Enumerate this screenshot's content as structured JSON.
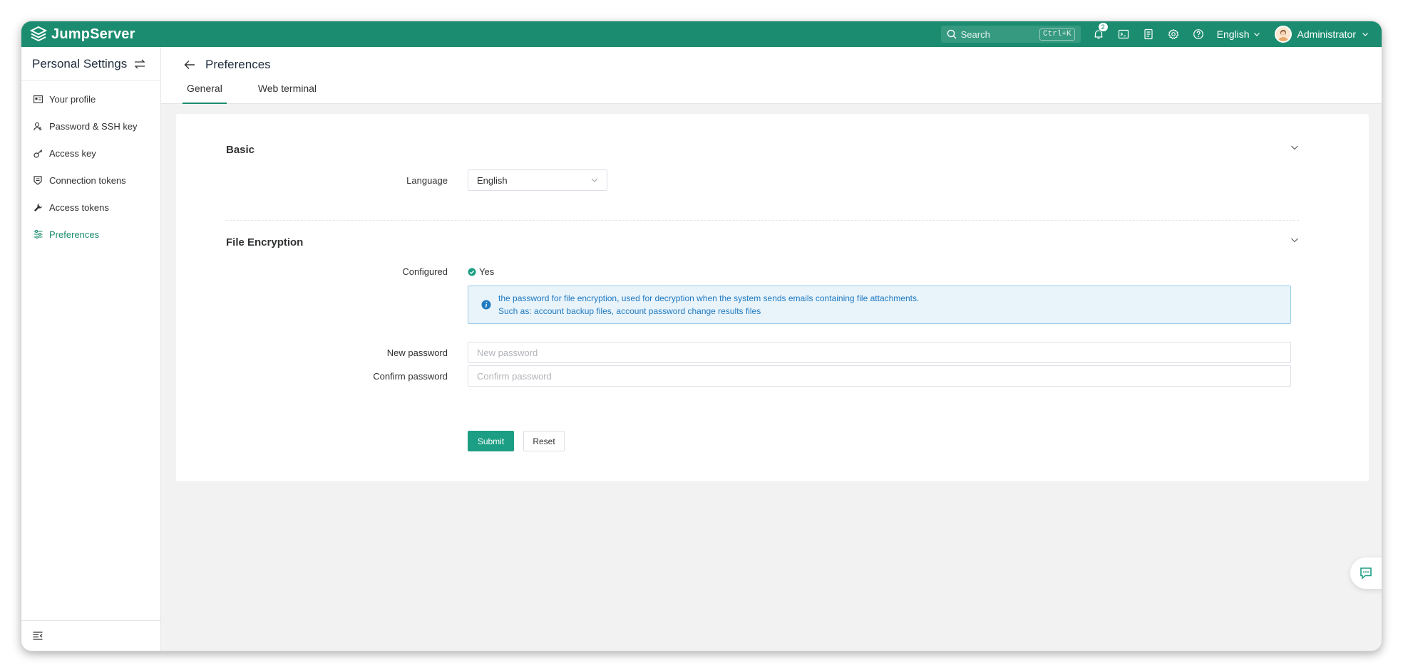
{
  "app": {
    "name": "JumpServer",
    "brand_color": "#1b8c6f"
  },
  "topbar": {
    "search_placeholder": "Search",
    "search_shortcut": "Ctrl+K",
    "notification_count": "2",
    "icons": [
      "bell-icon",
      "terminal-icon",
      "document-icon",
      "gear-icon",
      "help-icon"
    ],
    "language": "English",
    "user_name": "Administrator"
  },
  "sidebar": {
    "title": "Personal Settings",
    "items": [
      {
        "label": "Your profile",
        "icon": "profile-card-icon",
        "active": false
      },
      {
        "label": "Password & SSH key",
        "icon": "user-key-icon",
        "active": false
      },
      {
        "label": "Access key",
        "icon": "key-icon",
        "active": false
      },
      {
        "label": "Connection tokens",
        "icon": "shield-icon",
        "active": false
      },
      {
        "label": "Access tokens",
        "icon": "wrench-icon",
        "active": false
      },
      {
        "label": "Preferences",
        "icon": "sliders-icon",
        "active": true
      }
    ]
  },
  "page": {
    "title": "Preferences",
    "tabs": [
      {
        "label": "General",
        "active": true
      },
      {
        "label": "Web terminal",
        "active": false
      }
    ]
  },
  "basic": {
    "title": "Basic",
    "language_label": "Language",
    "language_value": "English"
  },
  "file_encryption": {
    "title": "File Encryption",
    "configured_label": "Configured",
    "configured_value": "Yes",
    "info_line1": "the password for file encryption, used for decryption when the system sends emails containing file attachments.",
    "info_line2": "Such as: account backup files, account password change results files",
    "new_password_label": "New password",
    "new_password_placeholder": "New password",
    "new_password_value": "",
    "confirm_password_label": "Confirm password",
    "confirm_password_placeholder": "Confirm password",
    "confirm_password_value": ""
  },
  "actions": {
    "submit": "Submit",
    "reset": "Reset"
  }
}
